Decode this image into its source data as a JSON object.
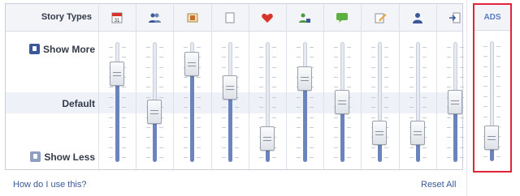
{
  "header": {
    "story_types_label": "Story Types"
  },
  "rows": {
    "show_more": "Show More",
    "default": "Default",
    "show_less": "Show Less"
  },
  "columns": [
    {
      "icon": "calendar-icon",
      "level": 0.8
    },
    {
      "icon": "friends-icon",
      "level": 0.4
    },
    {
      "icon": "photo-album-icon",
      "level": 0.9
    },
    {
      "icon": "note-icon",
      "level": 0.65
    },
    {
      "icon": "heart-icon",
      "level": 0.12
    },
    {
      "icon": "group-add-icon",
      "level": 0.75
    },
    {
      "icon": "chat-bubble-icon",
      "level": 0.5
    },
    {
      "icon": "pencil-note-icon",
      "level": 0.18
    },
    {
      "icon": "person-icon",
      "level": 0.18
    },
    {
      "icon": "share-arrow-icon",
      "level": 0.5
    }
  ],
  "ads": {
    "label": "ADS",
    "level": 0.12
  },
  "footer": {
    "help_link": "How do I use this?",
    "reset_link": "Reset All"
  },
  "colors": {
    "accent": "#3b5998",
    "fill": "#6b84be",
    "ads_highlight": "#e0243a"
  }
}
